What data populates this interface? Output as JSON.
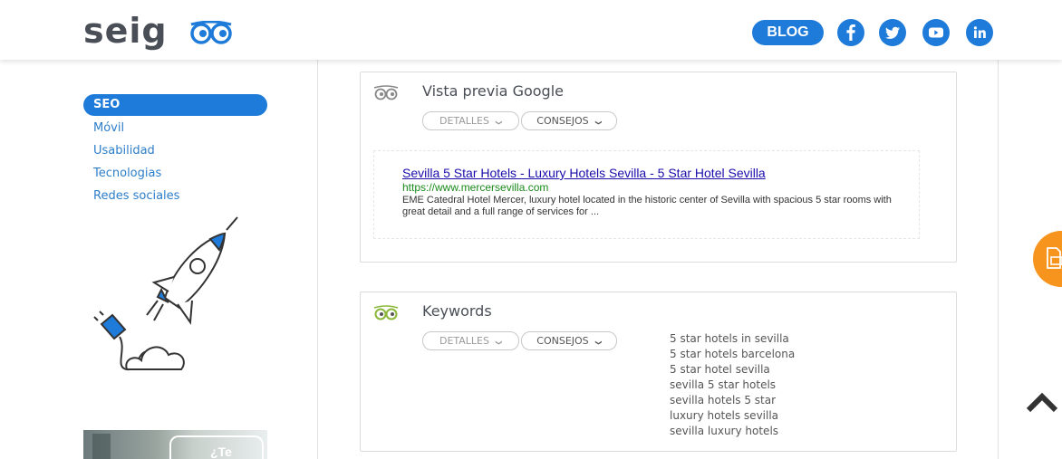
{
  "header": {
    "logo_text": "seig",
    "blog_label": "BLOG",
    "social": [
      "facebook-icon",
      "twitter-icon",
      "youtube-icon",
      "linkedin-icon"
    ]
  },
  "sidebar": {
    "items": [
      {
        "label": "SEO",
        "active": true
      },
      {
        "label": "Móvil"
      },
      {
        "label": "Usabilidad"
      },
      {
        "label": "Tecnologias"
      },
      {
        "label": "Redes sociales"
      }
    ],
    "banner_text": "¿Te"
  },
  "cards": {
    "google_preview": {
      "title": "Vista previa Google",
      "details_label": "DETALLES",
      "tips_label": "CONSEJOS",
      "result_title": "Sevilla 5 Star Hotels - Luxury Hotels Sevilla - 5 Star Hotel Sevilla",
      "result_url": "https://www.mercersevilla.com",
      "result_desc": "EME Catedral Hotel Mercer, luxury hotel located in the historic center of Sevilla with spacious 5 star rooms with great detail and a full range of services for ..."
    },
    "keywords": {
      "title": "Keywords",
      "details_label": "DETALLES",
      "tips_label": "CONSEJOS",
      "items": [
        "5 star hotels in sevilla",
        "5 star hotels barcelona",
        "5 star hotel sevilla",
        "sevilla 5 star hotels",
        "sevilla hotels 5 star",
        "luxury hotels sevilla",
        "sevilla luxury hotels"
      ]
    }
  },
  "colors": {
    "brand_blue": "#1e7bd9",
    "accent_orange": "#f7941d",
    "link_blue": "#1a0dab",
    "url_green": "#1a8a1a"
  }
}
